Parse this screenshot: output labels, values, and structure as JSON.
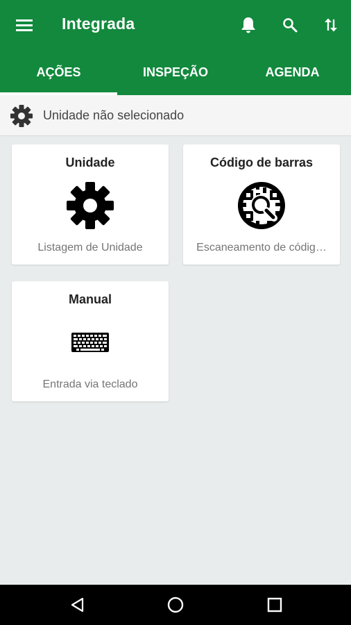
{
  "app": {
    "title": "Integrada"
  },
  "toolbar": {
    "menu_icon": "hamburger-menu-icon",
    "actions": [
      "bell-icon",
      "search-icon",
      "swap-vertical-icon"
    ]
  },
  "tabs": [
    {
      "label": "AÇÕES",
      "selected": true
    },
    {
      "label": "INSPEÇÃO",
      "selected": false
    },
    {
      "label": "AGENDA",
      "selected": false
    }
  ],
  "unit_bar": {
    "icon": "gear-icon",
    "label": "Unidade não selecionado"
  },
  "cards": [
    {
      "title": "Unidade",
      "icon": "gear-icon",
      "subtitle": "Listagem de Unidade"
    },
    {
      "title": "Código de barras",
      "icon": "qr-scan-icon",
      "subtitle": "Escaneamento de códig…"
    },
    {
      "title": "Manual",
      "icon": "keyboard-icon",
      "subtitle": "Entrada via teclado"
    }
  ],
  "navbar": {
    "buttons": [
      "back-icon",
      "home-icon",
      "recents-icon"
    ]
  },
  "colors": {
    "primary": "#12893d",
    "background": "#e8ecec",
    "card": "#ffffff",
    "navbar": "#000000"
  }
}
